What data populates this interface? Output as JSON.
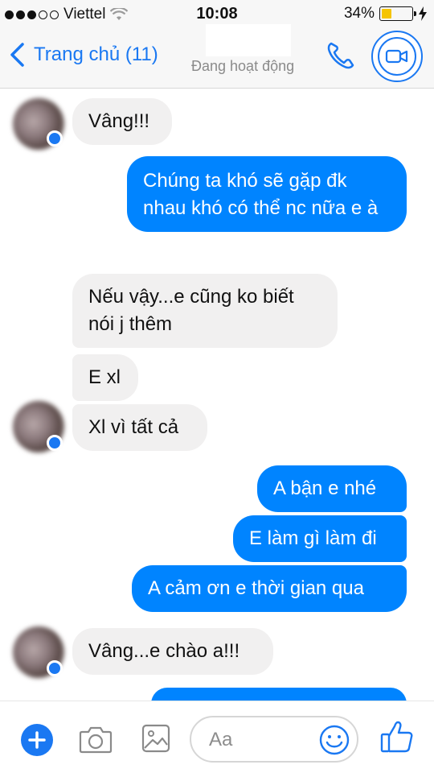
{
  "status_bar": {
    "carrier": "Viettel",
    "time": "10:08",
    "battery": "34%",
    "battery_level": 0.34
  },
  "header": {
    "back_label": "Trang chủ (11)",
    "status": "Đang hoạt động"
  },
  "messages": [
    {
      "side": "in",
      "text": "Vâng!!!"
    },
    {
      "side": "out",
      "text": "Chúng ta khó sẽ gặp đk nhau khó có thể nc nữa e à"
    },
    {
      "side": "in",
      "text": "Nếu vậy...e cũng ko biết nói j thêm"
    },
    {
      "side": "in",
      "text": "E xl"
    },
    {
      "side": "in",
      "text": "Xl vì tất cả"
    },
    {
      "side": "out",
      "text": "A bận e nhé"
    },
    {
      "side": "out",
      "text": "E làm gì làm đi"
    },
    {
      "side": "out",
      "text": "A cảm ơn e thời gian qua"
    },
    {
      "side": "in",
      "text": "Vâng...e chào a!!!"
    }
  ],
  "composer": {
    "placeholder": "Aa"
  },
  "colors": {
    "accent": "#1a78f2",
    "outgoing_bubble": "#0084ff",
    "incoming_bubble": "#f1f0f0"
  }
}
